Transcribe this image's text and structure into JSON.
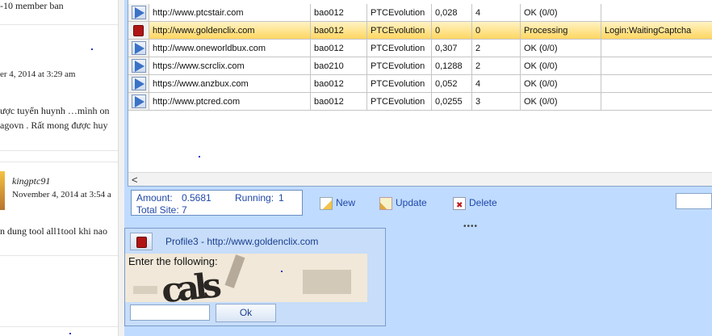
{
  "blog": {
    "lines": [
      "-10 member ban",
      "er 4, 2014 at 3:29 am",
      "ược tuyển huynh …mình on",
      "agovn . Rất mong được huy",
      "kingptc91",
      "November 4, 2014 at 3:54 a",
      "n dung tool all1tool khi nao"
    ]
  },
  "grid": {
    "rows": [
      {
        "url": "http://www.ptcstair.com",
        "user": "bao012",
        "script": "PTCEvolution",
        "amount": "0,028",
        "count": "4",
        "status": "OK (0/0)",
        "info": "",
        "state": "play"
      },
      {
        "url": "http://www.goldenclix.com",
        "user": "bao012",
        "script": "PTCEvolution",
        "amount": "0",
        "count": "0",
        "status": "Processing",
        "info": "Login:WaitingCaptcha",
        "state": "stop"
      },
      {
        "url": "http://www.oneworldbux.com",
        "user": "bao012",
        "script": "PTCEvolution",
        "amount": "0,307",
        "count": "2",
        "status": "OK (0/0)",
        "info": "",
        "state": "play"
      },
      {
        "url": "https://www.scrclix.com",
        "user": "bao210",
        "script": "PTCEvolution",
        "amount": "0,1288",
        "count": "2",
        "status": "OK (0/0)",
        "info": "",
        "state": "play"
      },
      {
        "url": "https://www.anzbux.com",
        "user": "bao012",
        "script": "PTCEvolution",
        "amount": "0,052",
        "count": "4",
        "status": "OK (0/0)",
        "info": "",
        "state": "play"
      },
      {
        "url": "http://www.ptcred.com",
        "user": "bao012",
        "script": "PTCEvolution",
        "amount": "0,0255",
        "count": "3",
        "status": "OK (0/0)",
        "info": "",
        "state": "play"
      }
    ],
    "scroll_left": "<"
  },
  "stats": {
    "amount_label": "Amount:",
    "amount_value": "0.5681",
    "running_label": "Running:",
    "running_value": "1",
    "total_label": "Total Site:",
    "total_value": "7"
  },
  "toolbar": {
    "new_label": "New",
    "update_label": "Update",
    "delete_label": "Delete"
  },
  "captcha": {
    "title": "Profile3 - http://www.goldenclix.com",
    "prompt": "Enter the following:",
    "image_text": "cals",
    "ok_label": "Ok",
    "input_value": ""
  },
  "colors": {
    "app_bg": "#bfdbff",
    "active_row": "#ffd661",
    "accent_text": "#1f47a8",
    "stop_red": "#b01414",
    "play_blue": "#3a72c6"
  }
}
